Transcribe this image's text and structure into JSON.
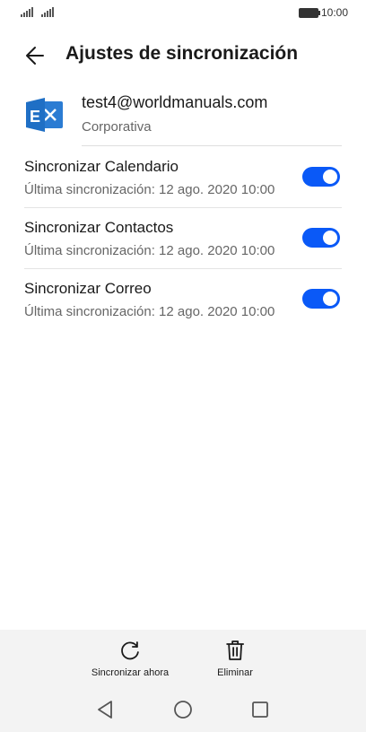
{
  "status_bar": {
    "time": "10:00"
  },
  "header": {
    "title": "Ajustes de sincronización"
  },
  "account": {
    "email": "test4@worldmanuals.com",
    "type": "Corporativa"
  },
  "sync_items": [
    {
      "title": "Sincronizar Calendario",
      "subtitle": "Última sincronización: 12 ago. 2020 10:00",
      "enabled": true
    },
    {
      "title": "Sincronizar Contactos",
      "subtitle": "Última sincronización: 12 ago. 2020 10:00",
      "enabled": true
    },
    {
      "title": "Sincronizar Correo",
      "subtitle": "Última sincronización: 12 ago. 2020 10:00",
      "enabled": true
    }
  ],
  "actions": {
    "sync_now": "Sincronizar ahora",
    "delete": "Eliminar"
  },
  "colors": {
    "accent": "#0a59f7",
    "exchange": "#1f6fc5"
  },
  "icons": [
    "back-arrow-icon",
    "exchange-icon",
    "sync-icon",
    "trash-icon",
    "nav-back-icon",
    "nav-home-icon",
    "nav-recents-icon"
  ]
}
